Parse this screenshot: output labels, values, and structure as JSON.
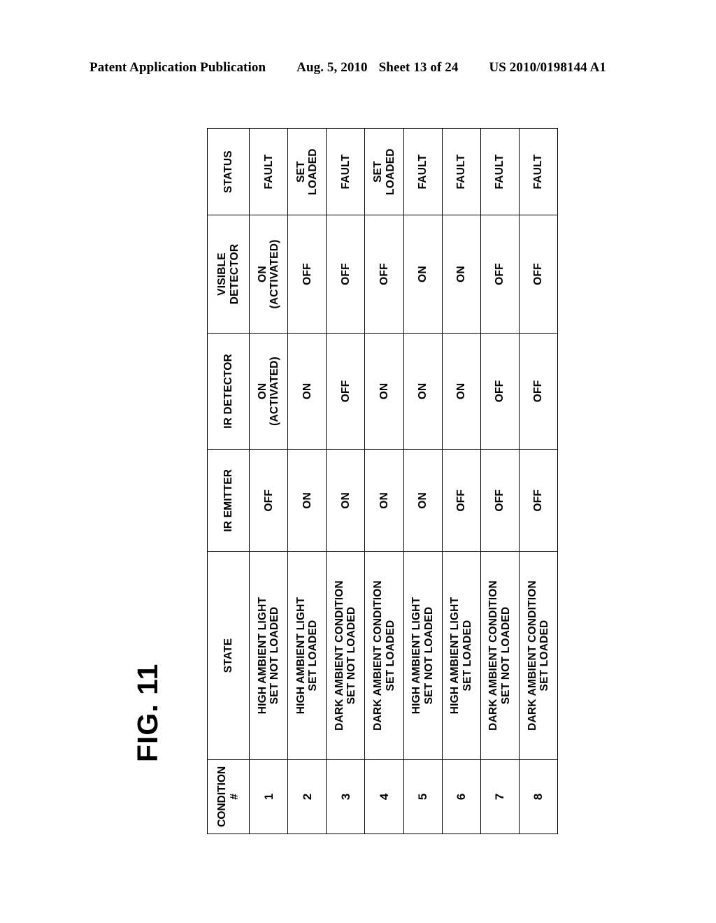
{
  "header": {
    "publication": "Patent Application Publication",
    "date": "Aug. 5, 2010",
    "sheet": "Sheet 13 of 24",
    "doc_number": "US 2010/0198144 A1"
  },
  "figure": {
    "label": "FIG. 11"
  },
  "table": {
    "columns": [
      "CONDITION #",
      "STATE",
      "IR EMITTER",
      "IR DETECTOR",
      "VISIBLE\nDETECTOR",
      "STATUS"
    ],
    "rows": [
      {
        "condition": "1",
        "state": "HIGH AMBIENT LIGHT\nSET NOT LOADED",
        "ir_emitter": "OFF",
        "ir_detector": "ON\n(ACTIVATED)",
        "visible_detector": "ON\n(ACTIVATED)",
        "status": "FAULT"
      },
      {
        "condition": "2",
        "state": "HIGH AMBIENT LIGHT\nSET LOADED",
        "ir_emitter": "ON",
        "ir_detector": "ON",
        "visible_detector": "OFF",
        "status": "SET\nLOADED"
      },
      {
        "condition": "3",
        "state": "DARK  AMBIENT CONDITION\nSET NOT LOADED",
        "ir_emitter": "ON",
        "ir_detector": "OFF",
        "visible_detector": "OFF",
        "status": "FAULT"
      },
      {
        "condition": "4",
        "state": "DARK  AMBIENT CONDITION\nSET LOADED",
        "ir_emitter": "ON",
        "ir_detector": "ON",
        "visible_detector": "OFF",
        "status": "SET\nLOADED"
      },
      {
        "condition": "5",
        "state": "HIGH AMBIENT LIGHT\nSET NOT LOADED",
        "ir_emitter": "ON",
        "ir_detector": "ON",
        "visible_detector": "ON",
        "status": "FAULT"
      },
      {
        "condition": "6",
        "state": "HIGH AMBIENT LIGHT\nSET LOADED",
        "ir_emitter": "OFF",
        "ir_detector": "ON",
        "visible_detector": "ON",
        "status": "FAULT"
      },
      {
        "condition": "7",
        "state": "DARK  AMBIENT CONDITION\nSET NOT LOADED",
        "ir_emitter": "OFF",
        "ir_detector": "OFF",
        "visible_detector": "OFF",
        "status": "FAULT"
      },
      {
        "condition": "8",
        "state": "DARK  AMBIENT CONDITION\nSET LOADED",
        "ir_emitter": "OFF",
        "ir_detector": "OFF",
        "visible_detector": "OFF",
        "status": "FAULT"
      }
    ]
  },
  "colors": {
    "page_background": "#ffffff",
    "ink": "#000000",
    "rule": "#000000"
  }
}
